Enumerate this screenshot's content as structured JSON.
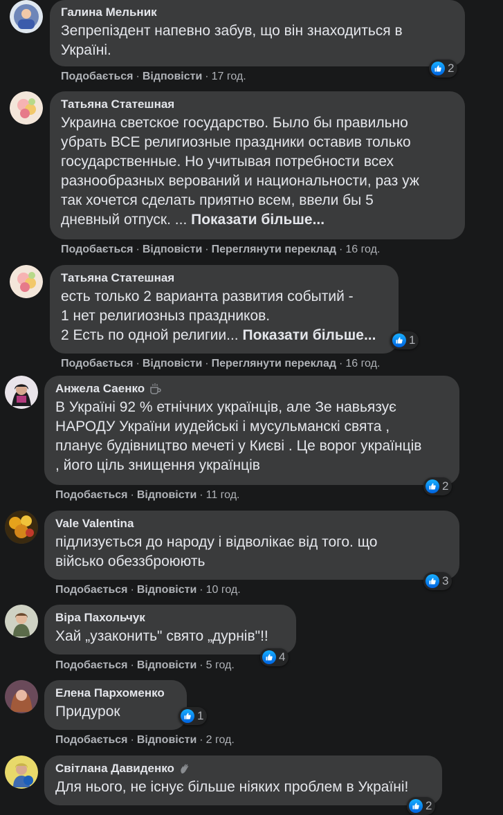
{
  "actions": {
    "like": "Подобається",
    "reply": "Відповісти",
    "translate": "Переглянути переклад",
    "separator": "·"
  },
  "comments": [
    {
      "author": "Галина Мельник",
      "lines": [
        "Зепрепіздент напевно забув, що він знаходиться в",
        "Україні."
      ],
      "reactions": "2",
      "time": "17 год."
    },
    {
      "author": "Татьяна Статешная",
      "lines": [
        "Украина светское государство. Было бы правильно",
        "убрать ВСЕ религиозные праздники оставив только",
        "государственные. Но учитывая потребности всех",
        "разнообразных верований и национальности, раз уж",
        "так хочется сделать приятно всем, ввели бы 5",
        "дневный отпуск. ..."
      ],
      "more": "Показати більше...",
      "time": "16 год."
    },
    {
      "author": "Татьяна Статешная",
      "lines": [
        "есть только 2 варианта развития событий -",
        "1 нет религиозныз праздников.",
        "2 Есть по одной религии..."
      ],
      "more": "Показати більше...",
      "reactions": "1",
      "time": "16 год."
    },
    {
      "author": "Анжела Саенко",
      "badge_icon": "coffee-cup-icon",
      "lines": [
        "В Україні 92 % етнічних українців, але Зе навьязує",
        "НАРОДУ України иудейські і мусульманскі свята ,",
        "планує будівництво мечеті у Києві . Це ворог українців",
        ", його ціль знищення українців"
      ],
      "reactions": "2",
      "time": "11 год."
    },
    {
      "author": "Vale Valentina",
      "lines": [
        "підлизується до народу і відволікає від того. що",
        "військо обеззброюють"
      ],
      "reactions": "3",
      "time": "10 год."
    },
    {
      "author": "Віра Пахольчук",
      "lines": [
        "Хай „узаконить\" свято „дурнів\"!!"
      ],
      "reactions": "4",
      "time": "5 год."
    },
    {
      "author": "Елена Пархоменко",
      "lines": [
        "Придурок"
      ],
      "reactions": "1",
      "time": "2 год."
    },
    {
      "author": "Світлана Давиденко",
      "badge_icon": "waving-hand-icon",
      "lines": [
        "Для нього, не існує більше ніяких проблем в Україні!"
      ],
      "reactions": "2"
    }
  ],
  "colors": {
    "background": "#18191a",
    "bubble": "#3a3b3c",
    "text": "#e4e6eb",
    "secondary_text": "#b0b3b8",
    "like_blue": "#1877f2"
  }
}
